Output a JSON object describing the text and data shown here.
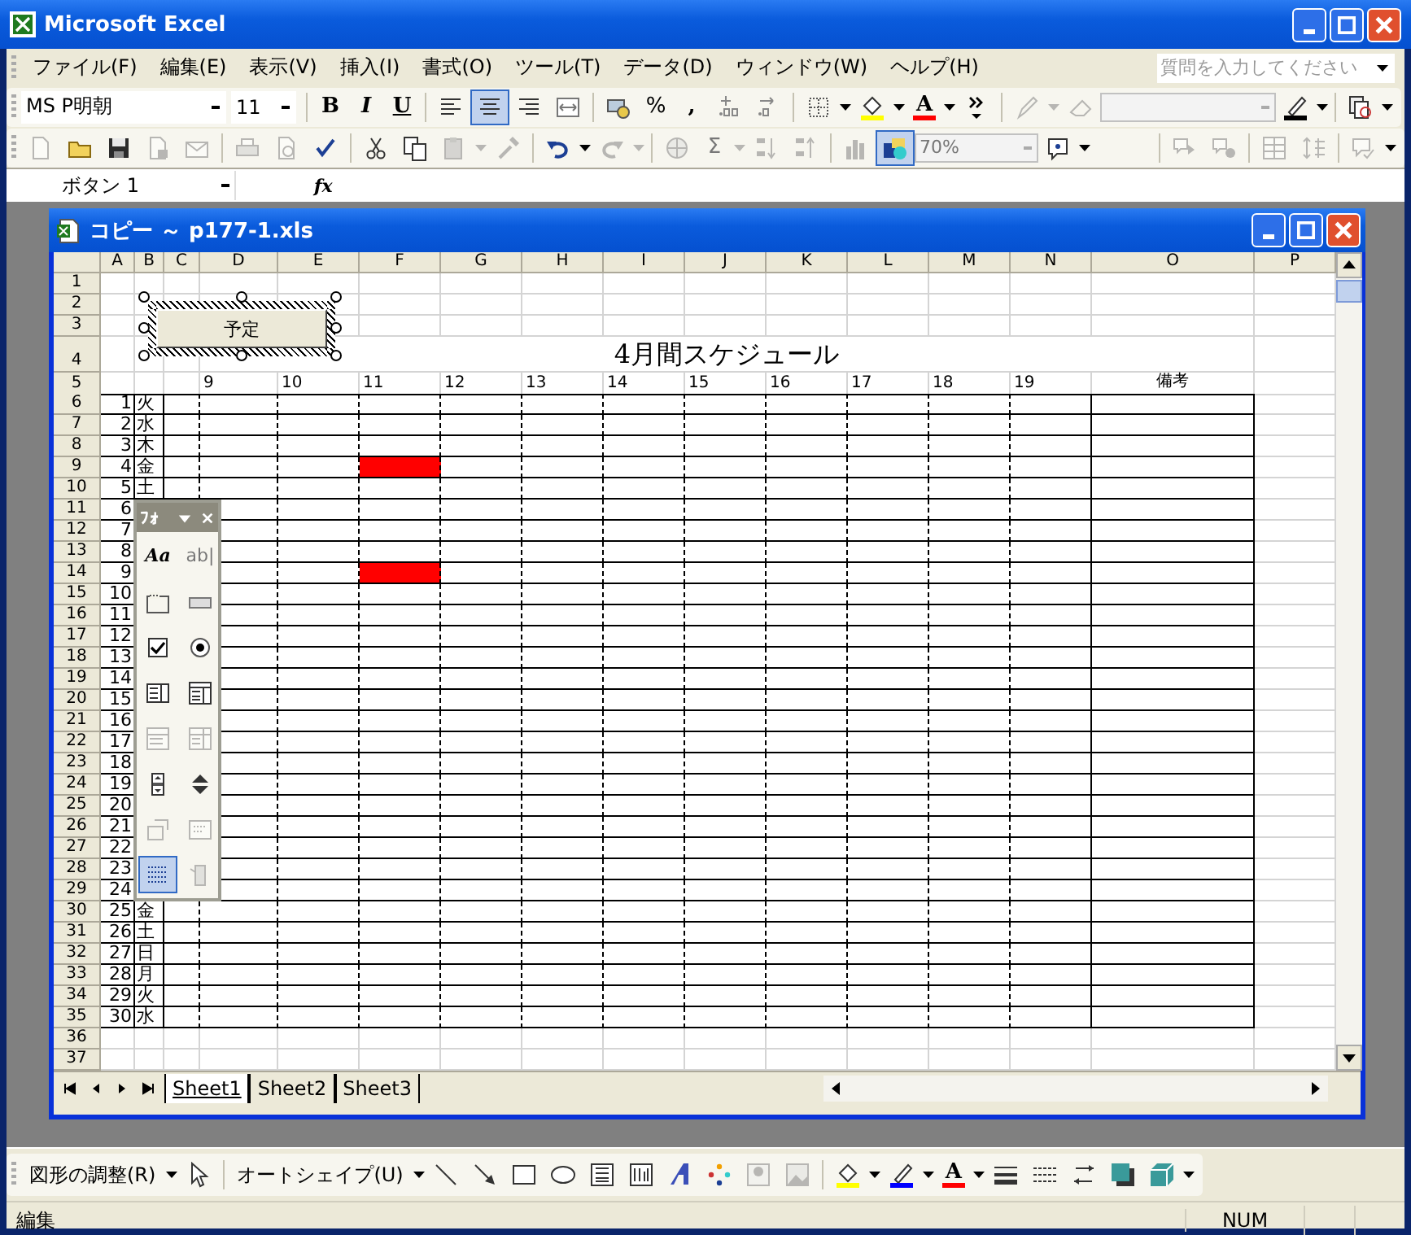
{
  "window": {
    "title": "Microsoft Excel"
  },
  "menu": [
    "ファイル(F)",
    "編集(E)",
    "表示(V)",
    "挿入(I)",
    "書式(O)",
    "ツール(T)",
    "データ(D)",
    "ウィンドウ(W)",
    "ヘルプ(H)"
  ],
  "help_search": {
    "placeholder": "質問を入力してください"
  },
  "formatting_toolbar": {
    "font": "MS P明朝",
    "size": "11",
    "groups": [
      [
        {
          "kind": "bold",
          "text": "B",
          "selected": false,
          "disabled": false
        },
        {
          "kind": "italic",
          "text": "I",
          "selected": false,
          "disabled": false
        },
        {
          "kind": "underline",
          "text": "U",
          "selected": false,
          "disabled": false
        }
      ],
      [
        {
          "kind": "align-left",
          "selected": false,
          "disabled": false
        },
        {
          "kind": "align-center",
          "selected": true,
          "disabled": false
        },
        {
          "kind": "align-right",
          "selected": false,
          "disabled": false
        },
        {
          "kind": "merge",
          "selected": false,
          "disabled": false
        }
      ],
      [
        {
          "kind": "currency",
          "selected": false,
          "disabled": false
        },
        {
          "kind": "text",
          "text": "%",
          "selected": false,
          "disabled": false
        },
        {
          "kind": "bold",
          "text": ",",
          "selected": false,
          "disabled": false
        },
        {
          "kind": "decimal-increase",
          "selected": false,
          "disabled": false
        },
        {
          "kind": "decimal-decrease",
          "selected": false,
          "disabled": false
        }
      ],
      [
        {
          "kind": "borders",
          "selected": false,
          "disabled": false
        },
        {
          "kind": "caret",
          "selected": false,
          "disabled": false
        },
        {
          "kind": "fill-color",
          "selected": false,
          "disabled": false
        },
        {
          "kind": "caret",
          "selected": false,
          "disabled": false
        },
        {
          "kind": "font-color",
          "text": "A",
          "selected": false,
          "disabled": false
        },
        {
          "kind": "caret",
          "selected": false,
          "disabled": false
        },
        {
          "kind": "more",
          "selected": false,
          "disabled": false
        }
      ],
      [
        {
          "kind": "pen",
          "selected": false,
          "disabled": true
        },
        {
          "kind": "caret",
          "selected": false,
          "disabled": true
        },
        {
          "kind": "eraser",
          "selected": false,
          "disabled": true
        },
        {
          "kind": "combo",
          "selected": false,
          "disabled": true
        },
        {
          "kind": "border-color",
          "selected": false,
          "disabled": false
        },
        {
          "kind": "caret",
          "selected": false,
          "disabled": false
        }
      ],
      [
        {
          "kind": "preview-stack",
          "selected": false,
          "disabled": false
        },
        {
          "kind": "caret",
          "selected": false,
          "disabled": false
        }
      ]
    ]
  },
  "standard_toolbar": {
    "groups": [
      [
        {
          "kind": "new",
          "selected": false,
          "disabled": true
        },
        {
          "kind": "open",
          "selected": false,
          "disabled": false
        },
        {
          "kind": "save",
          "selected": false,
          "disabled": false
        },
        {
          "kind": "permission",
          "selected": false,
          "disabled": true
        },
        {
          "kind": "email",
          "selected": false,
          "disabled": true
        }
      ],
      [
        {
          "kind": "print",
          "selected": false,
          "disabled": true
        },
        {
          "kind": "print-preview",
          "selected": false,
          "disabled": true
        },
        {
          "kind": "spelling",
          "selected": false,
          "disabled": false
        }
      ],
      [
        {
          "kind": "cut",
          "selected": false,
          "disabled": false
        },
        {
          "kind": "copy",
          "selected": false,
          "disabled": false
        },
        {
          "kind": "paste",
          "selected": false,
          "disabled": true
        },
        {
          "kind": "caret",
          "selected": false,
          "disabled": true
        },
        {
          "kind": "format-painter",
          "selected": false,
          "disabled": true
        }
      ],
      [
        {
          "kind": "undo",
          "selected": false,
          "disabled": false
        },
        {
          "kind": "caret",
          "selected": false,
          "disabled": false
        },
        {
          "kind": "redo",
          "selected": false,
          "disabled": true
        },
        {
          "kind": "caret",
          "selected": false,
          "disabled": true
        }
      ],
      [
        {
          "kind": "hyperlink",
          "selected": false,
          "disabled": true
        },
        {
          "kind": "text",
          "text": "Σ",
          "selected": false,
          "disabled": true
        },
        {
          "kind": "caret",
          "selected": false,
          "disabled": true
        },
        {
          "kind": "sort-asc",
          "selected": false,
          "disabled": true
        },
        {
          "kind": "sort-desc",
          "selected": false,
          "disabled": true
        }
      ],
      [
        {
          "kind": "chart",
          "selected": false,
          "disabled": true
        },
        {
          "kind": "drawing",
          "selected": true,
          "disabled": false
        },
        {
          "kind": "zoom-box",
          "text": "70%",
          "selected": false,
          "disabled": true
        },
        {
          "kind": "help",
          "selected": false,
          "disabled": false
        },
        {
          "kind": "caret",
          "selected": false,
          "disabled": false
        }
      ]
    ],
    "right_groups": [
      [
        {
          "kind": "comment-next",
          "selected": false,
          "disabled": true
        },
        {
          "kind": "comment-delete",
          "selected": false,
          "disabled": true
        }
      ],
      [
        {
          "kind": "table-rows",
          "selected": false,
          "disabled": true
        },
        {
          "kind": "row-height",
          "selected": false,
          "disabled": true
        }
      ],
      [
        {
          "kind": "comment-reply",
          "selected": false,
          "disabled": true
        },
        {
          "kind": "caret",
          "selected": false,
          "disabled": false
        }
      ]
    ]
  },
  "formula_bar": {
    "name_box": "ボタン 1",
    "function_label": "fx"
  },
  "workbook": {
    "title": "コピー ～ p177-1.xls",
    "columns": [
      "A",
      "B",
      "C",
      "D",
      "E",
      "F",
      "G",
      "H",
      "I",
      "J",
      "K",
      "L",
      "M",
      "N",
      "O",
      "P"
    ],
    "button": {
      "label": "予定"
    },
    "rows": [
      {
        "header": "1",
        "kind": "blank"
      },
      {
        "header": "2",
        "kind": "blank"
      },
      {
        "header": "3",
        "kind": "blank"
      },
      {
        "header": "4",
        "kind": "title",
        "title": "4月間スケジュール"
      },
      {
        "header": "5",
        "kind": "hours",
        "hours": [
          "9",
          "10",
          "11",
          "12",
          "13",
          "14",
          "15",
          "16",
          "17",
          "18",
          "19"
        ],
        "note": "備考"
      },
      {
        "header": "6",
        "kind": "day",
        "num": "1",
        "day": "火",
        "slots": [
          false,
          false,
          false,
          false,
          false,
          false,
          false,
          false,
          false,
          false,
          false
        ]
      },
      {
        "header": "7",
        "kind": "day",
        "num": "2",
        "day": "水",
        "slots": [
          false,
          false,
          false,
          false,
          false,
          false,
          false,
          false,
          false,
          false,
          false
        ]
      },
      {
        "header": "8",
        "kind": "day",
        "num": "3",
        "day": "木",
        "slots": [
          false,
          false,
          false,
          false,
          false,
          false,
          false,
          false,
          false,
          false,
          false
        ]
      },
      {
        "header": "9",
        "kind": "day",
        "num": "4",
        "day": "金",
        "slots": [
          false,
          false,
          true,
          false,
          false,
          false,
          false,
          false,
          false,
          false,
          false
        ]
      },
      {
        "header": "10",
        "kind": "day",
        "num": "5",
        "day": "土",
        "slots": [
          false,
          false,
          false,
          false,
          false,
          false,
          false,
          false,
          false,
          false,
          false
        ]
      },
      {
        "header": "11",
        "kind": "day",
        "num": "6",
        "slots": [
          false,
          false,
          false,
          false,
          false,
          false,
          false,
          false,
          false,
          false,
          false
        ]
      },
      {
        "header": "12",
        "kind": "day",
        "num": "7",
        "slots": [
          false,
          false,
          false,
          false,
          false,
          false,
          false,
          false,
          false,
          false,
          false
        ]
      },
      {
        "header": "13",
        "kind": "day",
        "num": "8",
        "slots": [
          false,
          false,
          false,
          false,
          false,
          false,
          false,
          false,
          false,
          false,
          false
        ]
      },
      {
        "header": "14",
        "kind": "day",
        "num": "9",
        "slots": [
          false,
          false,
          true,
          false,
          false,
          false,
          false,
          false,
          false,
          false,
          false
        ]
      },
      {
        "header": "15",
        "kind": "day",
        "num": "10",
        "slots": [
          false,
          false,
          false,
          false,
          false,
          false,
          false,
          false,
          false,
          false,
          false
        ]
      },
      {
        "header": "16",
        "kind": "day",
        "num": "11",
        "slots": [
          false,
          false,
          false,
          false,
          false,
          false,
          false,
          false,
          false,
          false,
          false
        ]
      },
      {
        "header": "17",
        "kind": "day",
        "num": "12",
        "slots": [
          false,
          false,
          false,
          false,
          false,
          false,
          false,
          false,
          false,
          false,
          false
        ]
      },
      {
        "header": "18",
        "kind": "day",
        "num": "13",
        "slots": [
          false,
          false,
          false,
          false,
          false,
          false,
          false,
          false,
          false,
          false,
          false
        ]
      },
      {
        "header": "19",
        "kind": "day",
        "num": "14",
        "slots": [
          false,
          false,
          false,
          false,
          false,
          false,
          false,
          false,
          false,
          false,
          false
        ]
      },
      {
        "header": "20",
        "kind": "day",
        "num": "15",
        "slots": [
          false,
          false,
          false,
          false,
          false,
          false,
          false,
          false,
          false,
          false,
          false
        ]
      },
      {
        "header": "21",
        "kind": "day",
        "num": "16",
        "slots": [
          false,
          false,
          false,
          false,
          false,
          false,
          false,
          false,
          false,
          false,
          false
        ]
      },
      {
        "header": "22",
        "kind": "day",
        "num": "17",
        "slots": [
          false,
          false,
          false,
          false,
          false,
          false,
          false,
          false,
          false,
          false,
          false
        ]
      },
      {
        "header": "23",
        "kind": "day",
        "num": "18",
        "slots": [
          false,
          false,
          false,
          false,
          false,
          false,
          false,
          false,
          false,
          false,
          false
        ]
      },
      {
        "header": "24",
        "kind": "day",
        "num": "19",
        "slots": [
          false,
          false,
          false,
          false,
          false,
          false,
          false,
          false,
          false,
          false,
          false
        ]
      },
      {
        "header": "25",
        "kind": "day",
        "num": "20",
        "slots": [
          false,
          false,
          false,
          false,
          false,
          false,
          false,
          false,
          false,
          false,
          false
        ]
      },
      {
        "header": "26",
        "kind": "day",
        "num": "21",
        "slots": [
          false,
          false,
          false,
          false,
          false,
          false,
          false,
          false,
          false,
          false,
          false
        ]
      },
      {
        "header": "27",
        "kind": "day",
        "num": "22",
        "slots": [
          false,
          false,
          false,
          false,
          false,
          false,
          false,
          false,
          false,
          false,
          false
        ]
      },
      {
        "header": "28",
        "kind": "day",
        "num": "23",
        "slots": [
          false,
          false,
          false,
          false,
          false,
          false,
          false,
          false,
          false,
          false,
          false
        ]
      },
      {
        "header": "29",
        "kind": "day",
        "num": "24",
        "slots": [
          false,
          false,
          false,
          false,
          false,
          false,
          false,
          false,
          false,
          false,
          false
        ]
      },
      {
        "header": "30",
        "kind": "day",
        "num": "25",
        "day": "金",
        "slots": [
          false,
          false,
          false,
          false,
          false,
          false,
          false,
          false,
          false,
          false,
          false
        ]
      },
      {
        "header": "31",
        "kind": "day",
        "num": "26",
        "day": "土",
        "slots": [
          false,
          false,
          false,
          false,
          false,
          false,
          false,
          false,
          false,
          false,
          false
        ]
      },
      {
        "header": "32",
        "kind": "day",
        "num": "27",
        "day": "日",
        "slots": [
          false,
          false,
          false,
          false,
          false,
          false,
          false,
          false,
          false,
          false,
          false
        ]
      },
      {
        "header": "33",
        "kind": "day",
        "num": "28",
        "day": "月",
        "slots": [
          false,
          false,
          false,
          false,
          false,
          false,
          false,
          false,
          false,
          false,
          false
        ]
      },
      {
        "header": "34",
        "kind": "day",
        "num": "29",
        "day": "火",
        "slots": [
          false,
          false,
          false,
          false,
          false,
          false,
          false,
          false,
          false,
          false,
          false
        ]
      },
      {
        "header": "35",
        "kind": "day",
        "num": "30",
        "day": "水",
        "slots": [
          false,
          false,
          false,
          false,
          false,
          false,
          false,
          false,
          false,
          false,
          false
        ]
      },
      {
        "header": "36",
        "kind": "blank"
      },
      {
        "header": "37",
        "kind": "blank"
      }
    ],
    "tabs": [
      {
        "label": "Sheet1",
        "selected": true
      },
      {
        "label": "Sheet2",
        "selected": false
      },
      {
        "label": "Sheet3",
        "selected": false
      }
    ]
  },
  "forms_toolbar": {
    "title": "ﾌｫ",
    "items": [
      {
        "kind": "serif",
        "text": "Aa",
        "selected": false,
        "disabled": false
      },
      {
        "kind": "text",
        "text": "ab|",
        "selected": false,
        "disabled": true
      },
      {
        "kind": "group-box",
        "selected": false,
        "disabled": false
      },
      {
        "kind": "push-button",
        "selected": false,
        "disabled": false
      },
      {
        "kind": "checkbox",
        "selected": false,
        "disabled": false
      },
      {
        "kind": "option-button",
        "selected": false,
        "disabled": false
      },
      {
        "kind": "list-box",
        "selected": false,
        "disabled": false
      },
      {
        "kind": "combo-box",
        "selected": false,
        "disabled": false
      },
      {
        "kind": "combo-list-edit",
        "selected": false,
        "disabled": true
      },
      {
        "kind": "combo-dropdown-edit",
        "selected": false,
        "disabled": true
      },
      {
        "kind": "scroll-bar",
        "selected": false,
        "disabled": false
      },
      {
        "kind": "spinner",
        "selected": false,
        "disabled": false
      },
      {
        "kind": "control-properties",
        "selected": false,
        "disabled": true
      },
      {
        "kind": "edit-code",
        "selected": false,
        "disabled": true
      },
      {
        "kind": "toggle-grid",
        "selected": true,
        "disabled": false
      },
      {
        "kind": "run-dialog",
        "selected": false,
        "disabled": true
      }
    ]
  },
  "drawing_toolbar": {
    "groups": [
      [
        {
          "kind": "menu",
          "text": "図形の調整(R)",
          "selected": false,
          "disabled": false
        },
        {
          "kind": "caret",
          "selected": false,
          "disabled": false
        },
        {
          "kind": "select",
          "selected": false,
          "disabled": false
        }
      ],
      [
        {
          "kind": "menu",
          "text": "オートシェイプ(U)",
          "selected": false,
          "disabled": false
        },
        {
          "kind": "caret",
          "selected": false,
          "disabled": false
        },
        {
          "kind": "line",
          "selected": false,
          "disabled": false
        },
        {
          "kind": "arrow",
          "selected": false,
          "disabled": false
        },
        {
          "kind": "rectangle",
          "selected": false,
          "disabled": false
        },
        {
          "kind": "oval",
          "selected": false,
          "disabled": false
        },
        {
          "kind": "text-box",
          "selected": false,
          "disabled": false
        },
        {
          "kind": "vertical-text-box",
          "selected": false,
          "disabled": false
        },
        {
          "kind": "wordart",
          "selected": false,
          "disabled": false
        },
        {
          "kind": "diagram",
          "selected": false,
          "disabled": false
        },
        {
          "kind": "clip-art",
          "selected": false,
          "disabled": true
        },
        {
          "kind": "picture",
          "selected": false,
          "disabled": true
        }
      ],
      [
        {
          "kind": "fill-color",
          "selected": false,
          "disabled": false
        },
        {
          "kind": "caret",
          "selected": false,
          "disabled": false
        },
        {
          "kind": "line-color",
          "selected": false,
          "disabled": false
        },
        {
          "kind": "caret",
          "selected": false,
          "disabled": false
        },
        {
          "kind": "font-color",
          "text": "A",
          "selected": false,
          "disabled": false
        },
        {
          "kind": "caret",
          "selected": false,
          "disabled": false
        },
        {
          "kind": "line-style",
          "selected": false,
          "disabled": false
        },
        {
          "kind": "dash-style",
          "selected": false,
          "disabled": false
        },
        {
          "kind": "arrow-style",
          "selected": false,
          "disabled": false
        },
        {
          "kind": "shadow",
          "selected": false,
          "disabled": false
        },
        {
          "kind": "cube",
          "selected": false,
          "disabled": false
        },
        {
          "kind": "caret",
          "selected": false,
          "disabled": false
        }
      ]
    ]
  },
  "status_bar": {
    "mode": "編集",
    "indicators": [
      "NUM"
    ]
  }
}
